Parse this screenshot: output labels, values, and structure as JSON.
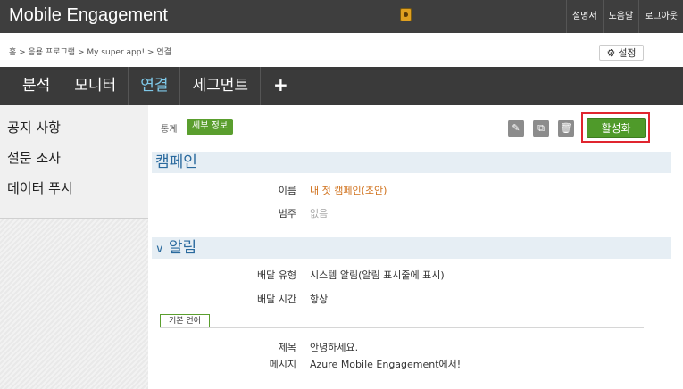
{
  "header": {
    "app_title": "Mobile Engagement",
    "links": [
      "설명서",
      "도움말",
      "로그아웃"
    ]
  },
  "breadcrumb": "홈 > 응용 프로그램 > My super app! > 연결",
  "settings_label": "설정",
  "nav": {
    "items": [
      "분석",
      "모니터",
      "연결",
      "세그먼트"
    ],
    "active": "연결",
    "add_label": "+"
  },
  "sidebar": {
    "items": [
      "공지 사항",
      "설문 조사",
      "데이터 푸시"
    ]
  },
  "main": {
    "tabs": {
      "stats": "통계",
      "detail": "세부 정보"
    },
    "activate_label": "활성화",
    "campaign": {
      "heading": "캠페인",
      "name_label": "이름",
      "name_value": "내 첫 캠페인(초안)",
      "category_label": "범주",
      "category_value": "없음"
    },
    "notification": {
      "heading": "알림",
      "delivery_type_label": "배달 유형",
      "delivery_type_value": "시스템 알림(알림 표시줄에 표시)",
      "delivery_time_label": "배달 시간",
      "delivery_time_value": "항상",
      "language_tab": "기본 언어",
      "title_label": "제목",
      "title_value": "안녕하세요.",
      "message_label": "메시지",
      "message_value": "Azure Mobile Engagement에서!"
    }
  },
  "colors": {
    "topbar": "#3e3e3e",
    "accent_green": "#4f9a2a",
    "highlight_red": "#e0252f",
    "section_blue": "#2a6a9e",
    "active_nav": "#7ec8e8"
  }
}
